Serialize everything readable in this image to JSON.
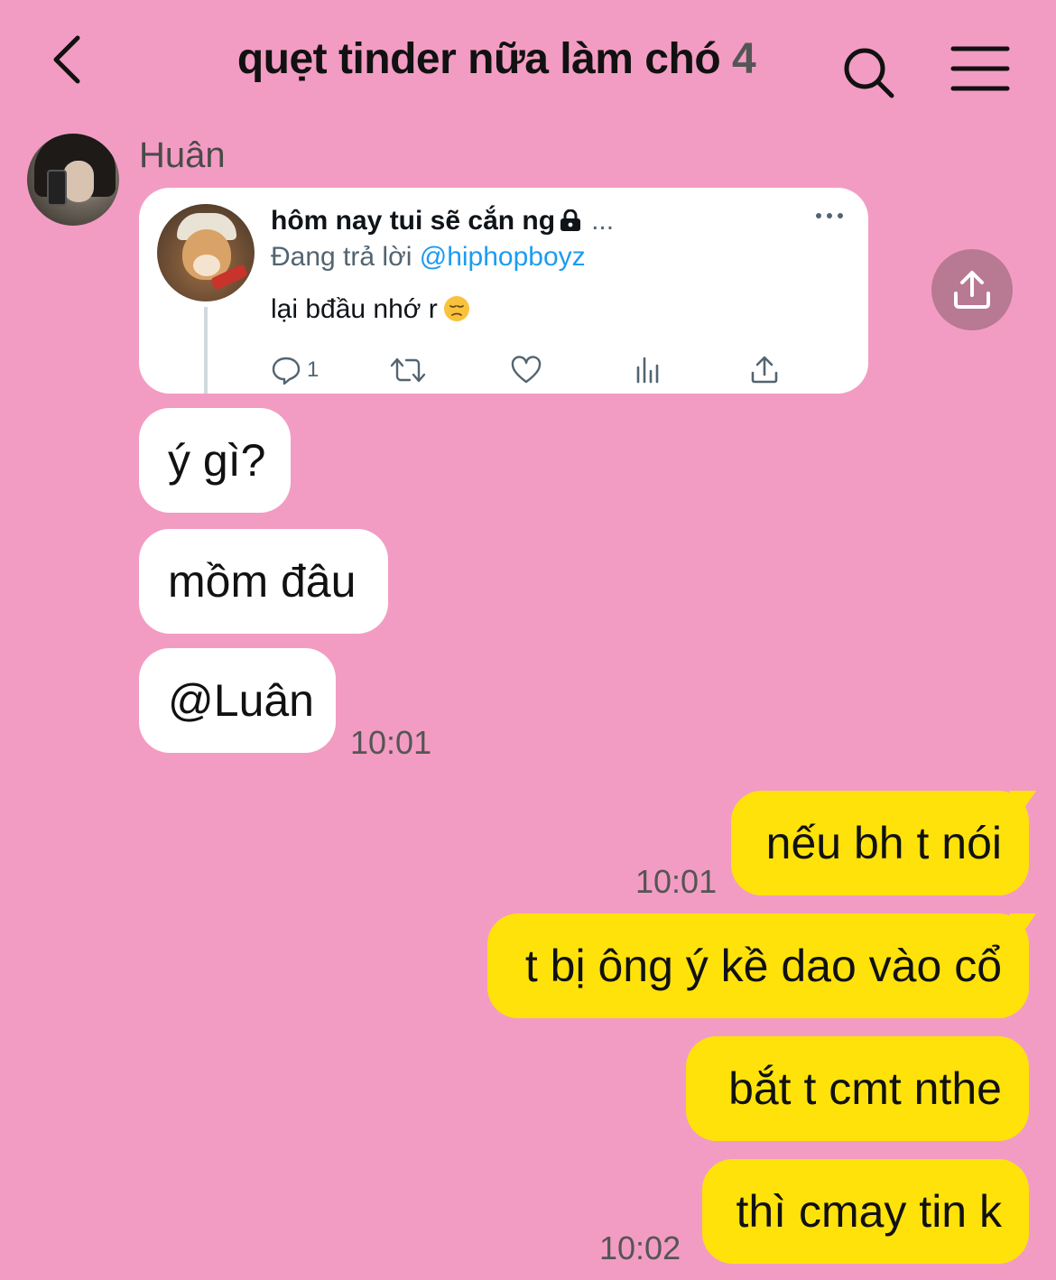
{
  "header": {
    "title": "quẹt tinder nữa làm chó",
    "member_count": "4"
  },
  "sender": {
    "name": "Huân"
  },
  "tweet": {
    "author": "hôm nay tui sẽ cắn ng",
    "author_truncation": "...",
    "replying_prefix": "Đang trả lời",
    "replying_to": "@hiphopboyz",
    "text": "lại bđầu nhớ r",
    "reply_count": "1"
  },
  "incoming": [
    {
      "text": "ý gì?"
    },
    {
      "text": "mồm đâu"
    },
    {
      "text": "@Luân",
      "time": "10:01"
    }
  ],
  "outgoing": [
    {
      "text": "nếu bh t nói",
      "time": "10:01"
    },
    {
      "text": "t bị ông ý kề dao vào cổ"
    },
    {
      "text": "bắt t cmt nthe"
    },
    {
      "text": "thì cmay tin k",
      "time": "10:02"
    }
  ],
  "colors": {
    "background": "#f39cc3",
    "incoming_bubble": "#ffffff",
    "outgoing_bubble": "#ffe20a",
    "link": "#1d9bf0",
    "share_button": "#b87992"
  }
}
